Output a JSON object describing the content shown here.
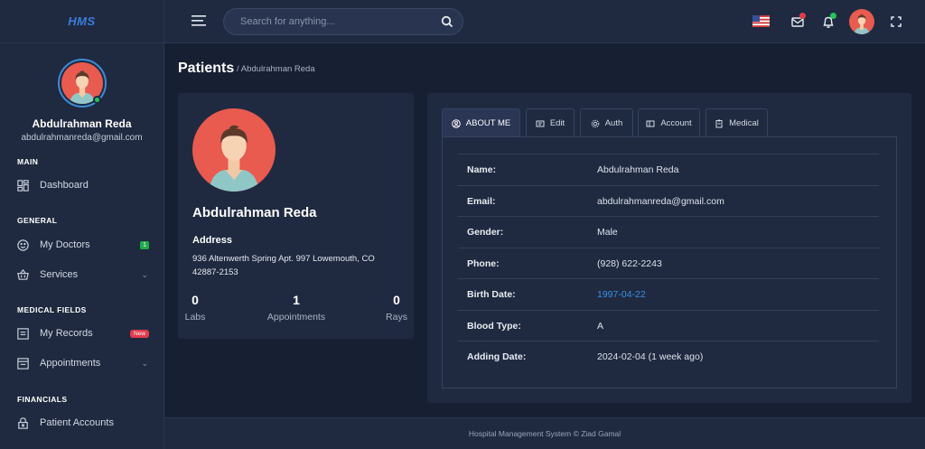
{
  "app": {
    "logo_text": "HMS"
  },
  "sidebar": {
    "user": {
      "name": "Abdulrahman Reda",
      "email": "abdulrahmanreda@gmail.com"
    },
    "sections": {
      "main": "MAIN",
      "general": "GENERAL",
      "medical": "MEDICAL FIELDS",
      "financials": "FINANCIALS"
    },
    "items": {
      "dashboard": {
        "label": "Dashboard",
        "icon": "grid-icon"
      },
      "my_doctors": {
        "label": "My Doctors",
        "icon": "smile-icon",
        "badge": "1"
      },
      "services": {
        "label": "Services",
        "icon": "basket-icon"
      },
      "my_records": {
        "label": "My Records",
        "icon": "list-icon",
        "badge": "New"
      },
      "appointments": {
        "label": "Appointments",
        "icon": "calendar-icon"
      },
      "patient_accounts": {
        "label": "Patient Accounts",
        "icon": "lock-icon"
      }
    }
  },
  "topbar": {
    "search_placeholder": "Search for anything...",
    "icons": [
      "menu-icon",
      "search-icon",
      "us-flag-icon",
      "mail-icon",
      "bell-icon",
      "fullscreen-icon"
    ]
  },
  "page": {
    "title": "Patients",
    "breadcrumb": "/ Abdulrahman Reda"
  },
  "profile_card": {
    "name": "Abdulrahman Reda",
    "address_title": "Address",
    "address": "936 Altenwerth Spring Apt. 997 Lowemouth, CO 42887-2153",
    "stats": [
      {
        "value": "0",
        "label": "Labs"
      },
      {
        "value": "1",
        "label": "Appointments"
      },
      {
        "value": "0",
        "label": "Rays"
      }
    ]
  },
  "tabs": [
    {
      "label": "ABOUT ME",
      "icon": "user-icon",
      "active": true
    },
    {
      "label": "Edit",
      "icon": "edit-icon"
    },
    {
      "label": "Auth",
      "icon": "gear-icon"
    },
    {
      "label": "Account",
      "icon": "wallet-icon"
    },
    {
      "label": "Medical",
      "icon": "clipboard-icon"
    }
  ],
  "about": [
    {
      "key": "Name:",
      "value": "Abdulrahman Reda"
    },
    {
      "key": "Email:",
      "value": "abdulrahmanreda@gmail.com"
    },
    {
      "key": "Gender:",
      "value": "Male"
    },
    {
      "key": "Phone:",
      "value": "(928) 622-2243"
    },
    {
      "key": "Birth Date:",
      "value": "1997-04-22"
    },
    {
      "key": "Blood Type:",
      "value": "A"
    },
    {
      "key": "Adding Date:",
      "value": "2024-02-04 (1 week ago)"
    }
  ],
  "footer": {
    "text": "Hospital Management System © Ziad Gamal"
  },
  "colors": {
    "accent": "#3b8fe6",
    "sidebar_bg": "#1f2a40",
    "page_bg": "#172033",
    "online": "#27c25a",
    "badge_new": "#e23b4b",
    "badge_count": "#22a94a"
  }
}
